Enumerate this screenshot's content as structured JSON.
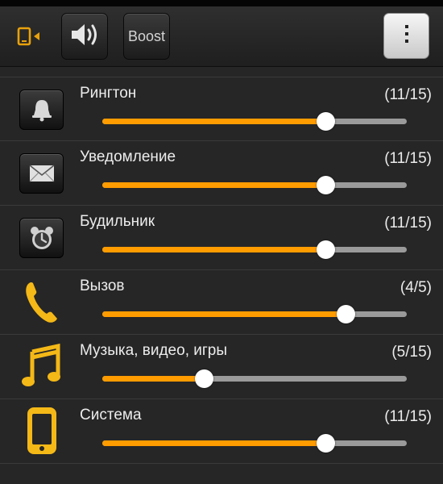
{
  "toolbar": {
    "vibrate_icon": "vibrate-icon",
    "sound_icon": "speaker-icon",
    "boost_label": "Boost",
    "menu_icon": "overflow-menu-icon"
  },
  "colors": {
    "accent": "#ff9c00",
    "track": "#9a9a9a",
    "icon_gold": "#f4b817",
    "background": "#262626"
  },
  "channels": [
    {
      "id": "ringtone",
      "label": "Рингтон",
      "count": "(11/15)",
      "level": 11,
      "max": 15,
      "icon": "bell-icon"
    },
    {
      "id": "notification",
      "label": "Уведомление",
      "count": "(11/15)",
      "level": 11,
      "max": 15,
      "icon": "envelope-icon"
    },
    {
      "id": "alarm",
      "label": "Будильник",
      "count": "(11/15)",
      "level": 11,
      "max": 15,
      "icon": "alarm-clock-icon"
    },
    {
      "id": "call",
      "label": "Вызов",
      "count": "(4/5)",
      "level": 4,
      "max": 5,
      "icon": "phone-handset-icon"
    },
    {
      "id": "media",
      "label": "Музыка, видео, игры",
      "count": "(5/15)",
      "level": 5,
      "max": 15,
      "icon": "music-note-icon"
    },
    {
      "id": "system",
      "label": "Система",
      "count": "(11/15)",
      "level": 11,
      "max": 15,
      "icon": "phone-device-icon"
    }
  ]
}
